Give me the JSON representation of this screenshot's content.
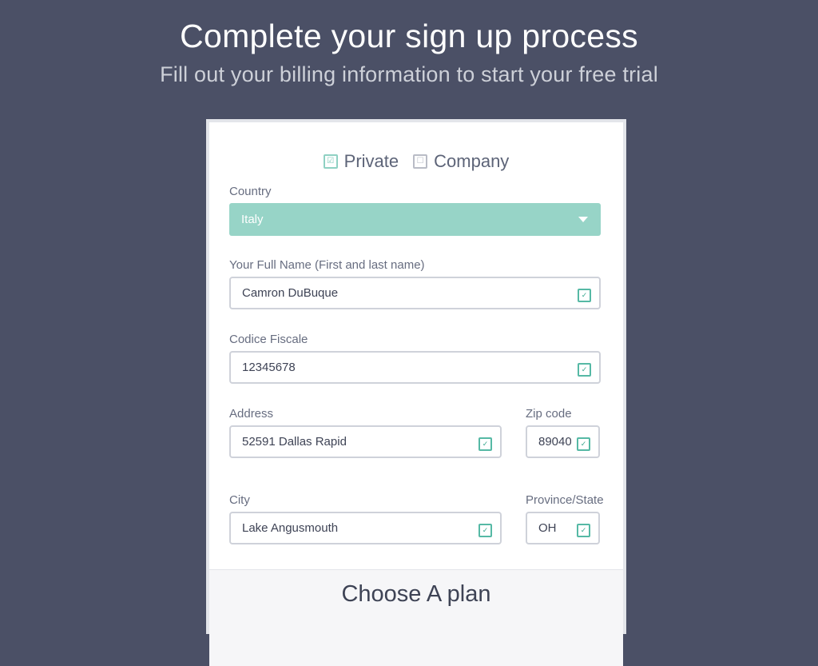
{
  "header": {
    "title": "Complete your sign up process",
    "subtitle": "Fill out your billing information to start your free trial"
  },
  "account_type": {
    "options": [
      {
        "label": "Private",
        "checked": true
      },
      {
        "label": "Company",
        "checked": false
      }
    ]
  },
  "form": {
    "country": {
      "label": "Country",
      "value": "Italy"
    },
    "full_name": {
      "label": "Your Full Name (First and last name)",
      "value": "Camron DuBuque"
    },
    "codice_fiscale": {
      "label": "Codice Fiscale",
      "value": "12345678"
    },
    "address": {
      "label": "Address",
      "value": "52591 Dallas Rapid"
    },
    "zip": {
      "label": "Zip code",
      "value": "89040"
    },
    "city": {
      "label": "City",
      "value": "Lake Angusmouth"
    },
    "province": {
      "label": "Province/State",
      "value": "OH"
    }
  },
  "plan": {
    "title": "Choose A plan"
  },
  "icons": {
    "checkbox": "checkbox-icon",
    "field_validation": "autofill-icon",
    "dropdown": "caret-down-icon"
  },
  "colors": {
    "background": "#4b5066",
    "accent": "#97d4c7",
    "icon_teal": "#56b9a5"
  }
}
